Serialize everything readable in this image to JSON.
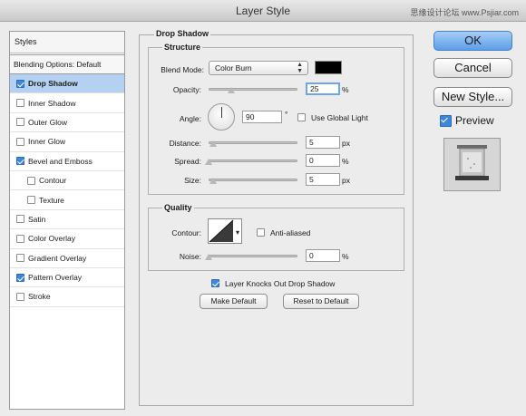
{
  "window": {
    "title": "Layer Style",
    "watermark": "思缘设计论坛 www.Psjiar.com"
  },
  "styles_list": {
    "header": "Styles",
    "blending_options": "Blending Options: Default",
    "items": [
      {
        "label": "Drop Shadow",
        "checked": true,
        "selected": true,
        "indent": false
      },
      {
        "label": "Inner Shadow",
        "checked": false,
        "selected": false,
        "indent": false
      },
      {
        "label": "Outer Glow",
        "checked": false,
        "selected": false,
        "indent": false
      },
      {
        "label": "Inner Glow",
        "checked": false,
        "selected": false,
        "indent": false
      },
      {
        "label": "Bevel and Emboss",
        "checked": true,
        "selected": false,
        "indent": false
      },
      {
        "label": "Contour",
        "checked": false,
        "selected": false,
        "indent": true
      },
      {
        "label": "Texture",
        "checked": false,
        "selected": false,
        "indent": true
      },
      {
        "label": "Satin",
        "checked": false,
        "selected": false,
        "indent": false
      },
      {
        "label": "Color Overlay",
        "checked": false,
        "selected": false,
        "indent": false
      },
      {
        "label": "Gradient Overlay",
        "checked": false,
        "selected": false,
        "indent": false
      },
      {
        "label": "Pattern Overlay",
        "checked": true,
        "selected": false,
        "indent": false
      },
      {
        "label": "Stroke",
        "checked": false,
        "selected": false,
        "indent": false
      }
    ]
  },
  "drop_shadow": {
    "group_title": "Drop Shadow",
    "structure": {
      "title": "Structure",
      "blend_mode_label": "Blend Mode:",
      "blend_mode_value": "Color Burn",
      "shadow_color": "#000000",
      "opacity_label": "Opacity:",
      "opacity_value": "25",
      "opacity_unit": "%",
      "angle_label": "Angle:",
      "angle_value": "90",
      "angle_unit": "°",
      "use_global_light_label": "Use Global Light",
      "use_global_light": false,
      "distance_label": "Distance:",
      "distance_value": "5",
      "distance_unit": "px",
      "spread_label": "Spread:",
      "spread_value": "0",
      "spread_unit": "%",
      "size_label": "Size:",
      "size_value": "5",
      "size_unit": "px"
    },
    "quality": {
      "title": "Quality",
      "contour_label": "Contour:",
      "anti_aliased_label": "Anti-aliased",
      "anti_aliased": false,
      "noise_label": "Noise:",
      "noise_value": "0",
      "noise_unit": "%"
    },
    "knocks_out_label": "Layer Knocks Out Drop Shadow",
    "knocks_out": true,
    "make_default": "Make Default",
    "reset_to_default": "Reset to Default"
  },
  "actions": {
    "ok": "OK",
    "cancel": "Cancel",
    "new_style": "New Style...",
    "preview_label": "Preview",
    "preview_checked": true
  },
  "colors": {
    "accent": "#3d86d9",
    "selection": "#b5d1f1"
  }
}
